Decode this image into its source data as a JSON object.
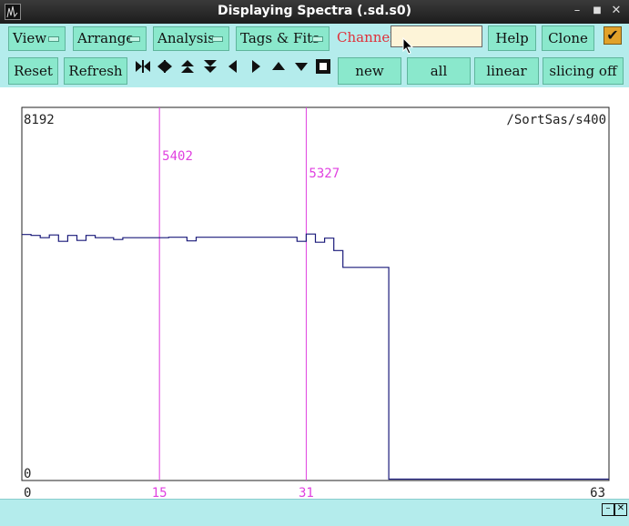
{
  "window": {
    "title": "Displaying Spectra (.sd.s0)"
  },
  "menus": [
    {
      "label": "View"
    },
    {
      "label": "Arrange"
    },
    {
      "label": "Analysis"
    },
    {
      "label": "Tags & Fits"
    }
  ],
  "channel": {
    "label": "Channel:",
    "value": ""
  },
  "buttons": {
    "help": "Help",
    "clone": "Clone",
    "reset": "Reset",
    "refresh": "Refresh",
    "new": "new",
    "all": "all",
    "linear": "linear",
    "slicing": "slicing off"
  },
  "nav_icons": [
    "expand-horizontal-icon",
    "compress-horizontal-icon",
    "expand-vertical-icon",
    "compress-vertical-icon",
    "shift-left-icon",
    "shift-right-icon",
    "shift-up-icon",
    "shift-down-icon",
    "full-view-icon"
  ],
  "plot": {
    "ymax_label": "8192",
    "ymin_label": "0",
    "spectrum_name": "/SortSas/s400",
    "x_ticks": [
      "0",
      "15",
      "31",
      "63"
    ],
    "markers": [
      {
        "channel": "15",
        "value": "5402"
      },
      {
        "channel": "31",
        "value": "5327"
      }
    ]
  },
  "chart_data": {
    "type": "line",
    "xlim": [
      0,
      63
    ],
    "ylim": [
      0,
      8192
    ],
    "x": [
      0,
      1,
      2,
      3,
      4,
      5,
      6,
      7,
      8,
      9,
      10,
      11,
      12,
      13,
      14,
      15,
      16,
      17,
      18,
      19,
      20,
      21,
      22,
      23,
      24,
      25,
      26,
      27,
      28,
      29,
      30,
      31,
      32,
      33,
      34,
      35,
      36,
      37,
      38,
      39,
      40,
      41,
      42,
      43,
      44,
      45,
      46,
      47,
      48,
      49,
      50,
      51,
      52,
      53,
      54,
      55,
      56,
      57,
      58,
      59,
      60,
      61,
      62,
      63
    ],
    "values": [
      5400,
      5380,
      5330,
      5390,
      5250,
      5380,
      5270,
      5380,
      5330,
      5330,
      5290,
      5330,
      5330,
      5330,
      5330,
      5330,
      5340,
      5340,
      5260,
      5340,
      5340,
      5340,
      5340,
      5340,
      5340,
      5340,
      5340,
      5340,
      5340,
      5340,
      5250,
      5410,
      5230,
      5320,
      5050,
      4680,
      4680,
      4680,
      4680,
      4680,
      30,
      30,
      30,
      30,
      30,
      30,
      30,
      30,
      30,
      30,
      30,
      30,
      30,
      30,
      30,
      30,
      30,
      30,
      30,
      30,
      30,
      30,
      30,
      30
    ],
    "colors": {
      "trace": "#1a1a7a",
      "marker": "#e040e0",
      "axis": "#555555"
    }
  }
}
